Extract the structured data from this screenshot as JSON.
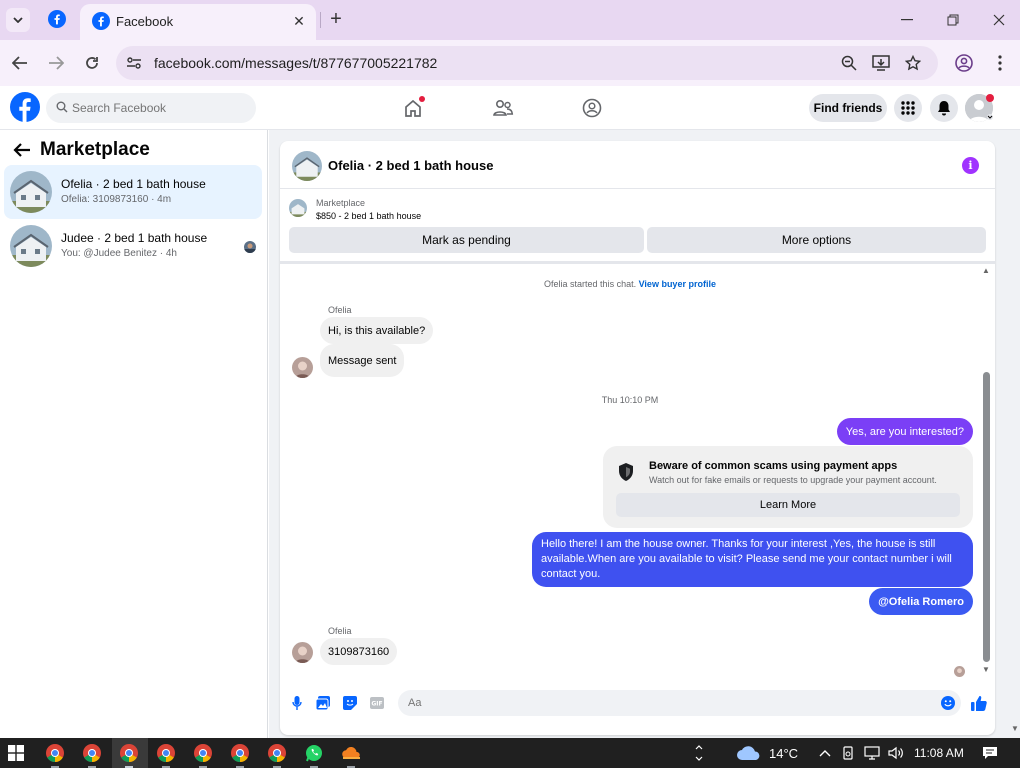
{
  "browser": {
    "tab_title": "Facebook",
    "url": "facebook.com/messages/t/877677005221782"
  },
  "fb_header": {
    "search_placeholder": "Search Facebook",
    "find_friends_label": "Find friends"
  },
  "left_panel": {
    "title": "Marketplace",
    "conversations": [
      {
        "title": "Ofelia · 2 bed 1 bath house",
        "subtitle": "Ofelia: 3109873160 · 4m",
        "active": true
      },
      {
        "title": "Judee · 2 bed 1 bath house",
        "subtitle": "You: @Judee Benitez · 4h",
        "active": false
      }
    ]
  },
  "chat": {
    "header_title": "Ofelia · 2 bed 1 bath house",
    "info_icon": "i",
    "listing_label": "Marketplace",
    "listing_detail": "$850 - 2 bed 1 bath house",
    "mark_pending_label": "Mark as pending",
    "more_options_label": "More options",
    "started_text": "Ofelia started this chat.",
    "view_buyer_label": "View buyer profile",
    "sender_name": "Ofelia",
    "msg_available": "Hi, is this available?",
    "msg_sent": "Message sent",
    "timestamp": "Thu 10:10 PM",
    "msg_yes": "Yes, are you interested?",
    "scam_title": "Beware of common scams using payment apps",
    "scam_subtitle": "Watch out for fake emails or requests to upgrade your payment account.",
    "learn_more_label": "Learn More",
    "msg_owner": "Hello there! I am the house owner. Thanks for your interest ,Yes, the house is still available.When are you available to visit? Please send me your contact number i will contact you.",
    "msg_mention": "@Ofelia Romero",
    "sender_name_2": "Ofelia",
    "msg_number": "3109873160",
    "composer_placeholder": "Aa"
  },
  "taskbar": {
    "temperature": "14°C",
    "time": "11:08 AM"
  },
  "colors": {
    "fb_blue": "#0866ff",
    "outgoing_purple": "#7b3ff6",
    "outgoing_blue": "#3f51f0",
    "browser_frame": "#e8d8f2"
  }
}
